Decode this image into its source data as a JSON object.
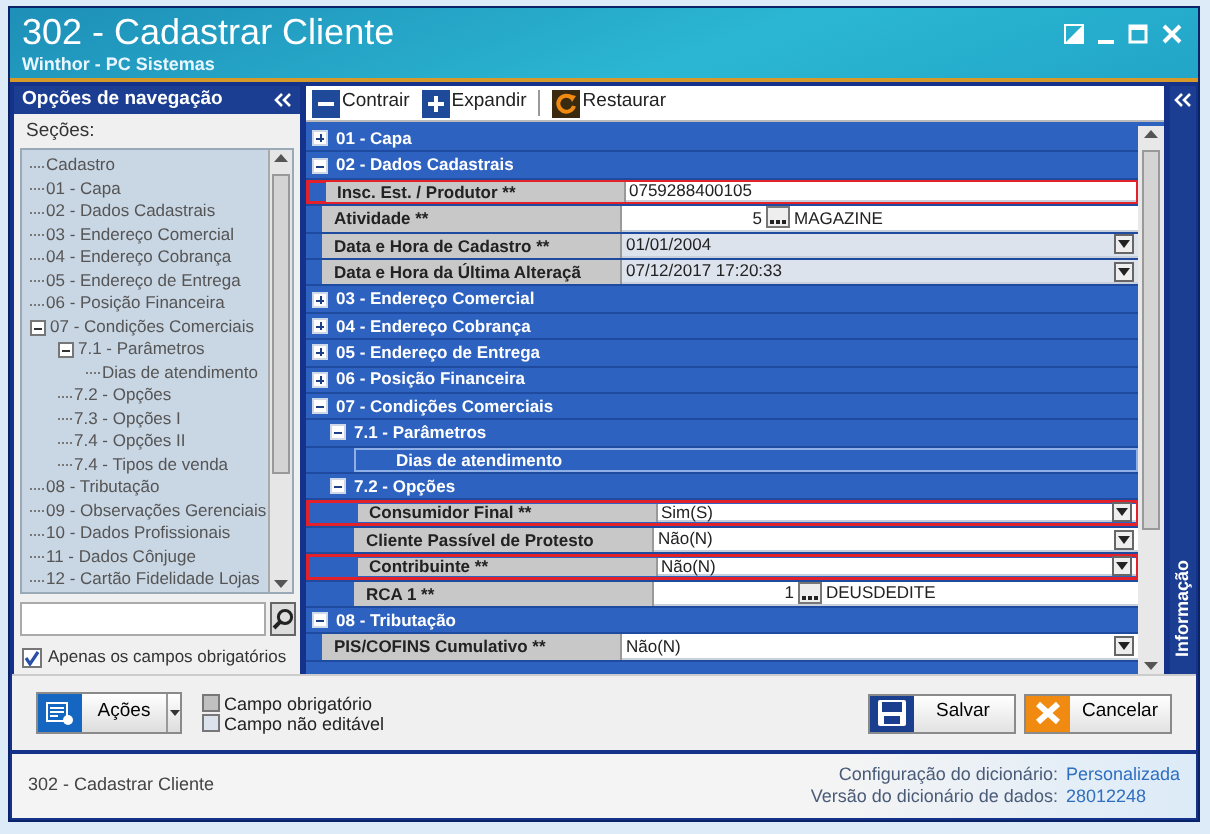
{
  "window": {
    "title": "302 - Cadastrar Cliente",
    "subtitle": "Winthor - PC Sistemas"
  },
  "navigation": {
    "title": "Opções de navegação",
    "sections_label": "Seções:",
    "tree": [
      {
        "label": "Cadastro"
      },
      {
        "label": "01 - Capa"
      },
      {
        "label": "02 - Dados Cadastrais"
      },
      {
        "label": "03 - Endereço Comercial"
      },
      {
        "label": "04 - Endereço Cobrança"
      },
      {
        "label": "05 - Endereço de Entrega"
      },
      {
        "label": "06 - Posição Financeira"
      },
      {
        "label": "07 - Condições Comerciais",
        "expanded": true,
        "children": [
          {
            "label": "7.1 - Parâmetros",
            "expanded": true,
            "children": [
              {
                "label": "Dias de atendimento"
              }
            ]
          },
          {
            "label": "7.2 - Opções"
          },
          {
            "label": "7.3 - Opções I"
          },
          {
            "label": "7.4 - Opções II"
          },
          {
            "label": "7.4 - Tipos de venda"
          }
        ]
      },
      {
        "label": "08 - Tributação"
      },
      {
        "label": "09 - Observações Gerenciais"
      },
      {
        "label": "10 - Dados Profissionais"
      },
      {
        "label": "11 - Dados Cônjuge"
      },
      {
        "label": "12 - Cartão Fidelidade Lojas"
      }
    ],
    "filter": {
      "label": "Apenas os campos obrigatórios",
      "checked": true
    }
  },
  "toolbar": [
    {
      "kind": "collapse",
      "label": "Contrair"
    },
    {
      "kind": "expand",
      "label": "Expandir"
    },
    {
      "kind": "restore",
      "label": "Restaurar"
    }
  ],
  "grid": [
    {
      "title": "01 - Capa",
      "expanded": false
    },
    {
      "title": "02 - Dados Cadastrais",
      "expanded": true,
      "children": [
        {
          "kind": "text",
          "label": "Insc. Est. / Produtor **",
          "value": "0759288400105",
          "highlighted": true
        },
        {
          "kind": "lookup",
          "label": "Atividade **",
          "code": "5",
          "value": "MAGAZINE",
          "highlighted": false
        },
        {
          "kind": "select",
          "label": "Data e Hora de Cadastro **",
          "value": "01/01/2004",
          "readonly": true,
          "highlighted": false
        },
        {
          "kind": "select",
          "label": "Data e Hora da Última Alteraçã",
          "value": "07/12/2017 17:20:33",
          "readonly": true,
          "highlighted": false
        }
      ]
    },
    {
      "title": "03 - Endereço Comercial",
      "expanded": false
    },
    {
      "title": "04 - Endereço Cobrança",
      "expanded": false
    },
    {
      "title": "05 - Endereço de Entrega",
      "expanded": false
    },
    {
      "title": "06 - Posição Financeira",
      "expanded": false
    },
    {
      "title": "07 - Condições Comerciais",
      "expanded": true,
      "children": [
        {
          "kind": "subsection",
          "title": "7.1 - Parâmetros",
          "expanded": true,
          "children": [
            {
              "kind": "group",
              "label": "Dias de atendimento"
            }
          ]
        },
        {
          "kind": "subsection",
          "title": "7.2 - Opções",
          "expanded": true,
          "children": [
            {
              "kind": "select",
              "label": "Consumidor Final **",
              "value": "Sim(S)",
              "readonly": false,
              "highlighted": true
            },
            {
              "kind": "select",
              "label": "Cliente Passível de Protesto",
              "value": "Não(N)",
              "readonly": false,
              "highlighted": false
            },
            {
              "kind": "select",
              "label": "Contribuinte **",
              "value": "Não(N)",
              "readonly": false,
              "highlighted": true
            },
            {
              "kind": "lookup",
              "label": "RCA 1 **",
              "code": "1",
              "value": "DEUSDEDITE",
              "highlighted": false
            }
          ]
        }
      ]
    },
    {
      "title": "08 - Tributação",
      "expanded": true,
      "children": [
        {
          "kind": "select",
          "label": "PIS/COFINS Cumulativo **",
          "value": "Não(N)",
          "readonly": false,
          "highlighted": false
        }
      ]
    }
  ],
  "side_panel": {
    "title": "Informação"
  },
  "actions": {
    "label": "Ações"
  },
  "legend": [
    {
      "kind": "required",
      "label": "Campo obrigatório"
    },
    {
      "kind": "readonly",
      "label": "Campo não editável"
    }
  ],
  "buttons": [
    {
      "kind": "save",
      "label": "Salvar"
    },
    {
      "kind": "cancel",
      "label": "Cancelar"
    }
  ],
  "status_bar": {
    "screen": "302 - Cadastrar Cliente",
    "info": [
      {
        "label": "Configuração do dicionário:",
        "value": "Personalizada"
      },
      {
        "label": "Versão do dicionário de dados:",
        "value": "28012248"
      }
    ]
  }
}
